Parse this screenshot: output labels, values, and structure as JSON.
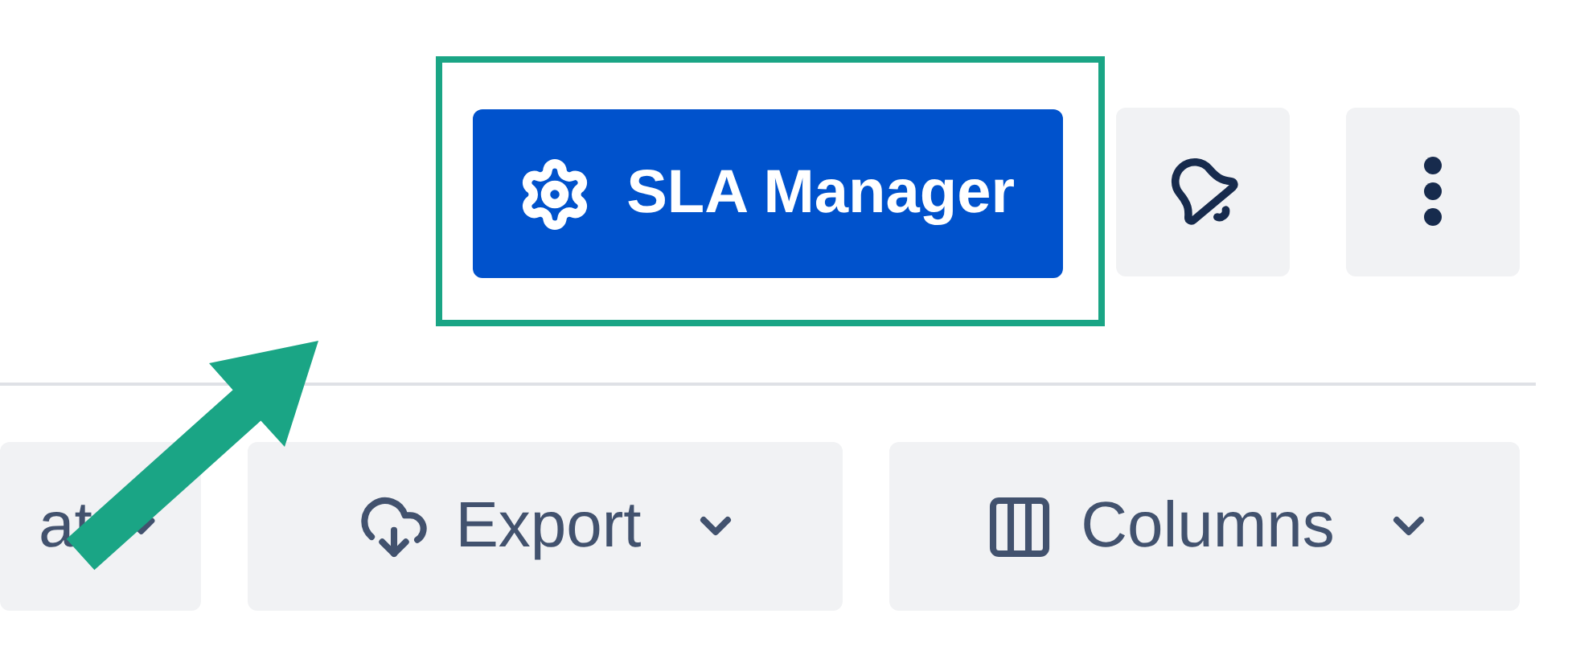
{
  "header_actions": {
    "primary_button": {
      "label": "SLA Manager",
      "highlighted": true
    }
  },
  "toolbar": {
    "buttons": [
      {
        "label": "at"
      },
      {
        "label": "Export"
      },
      {
        "label": "Columns"
      }
    ]
  }
}
